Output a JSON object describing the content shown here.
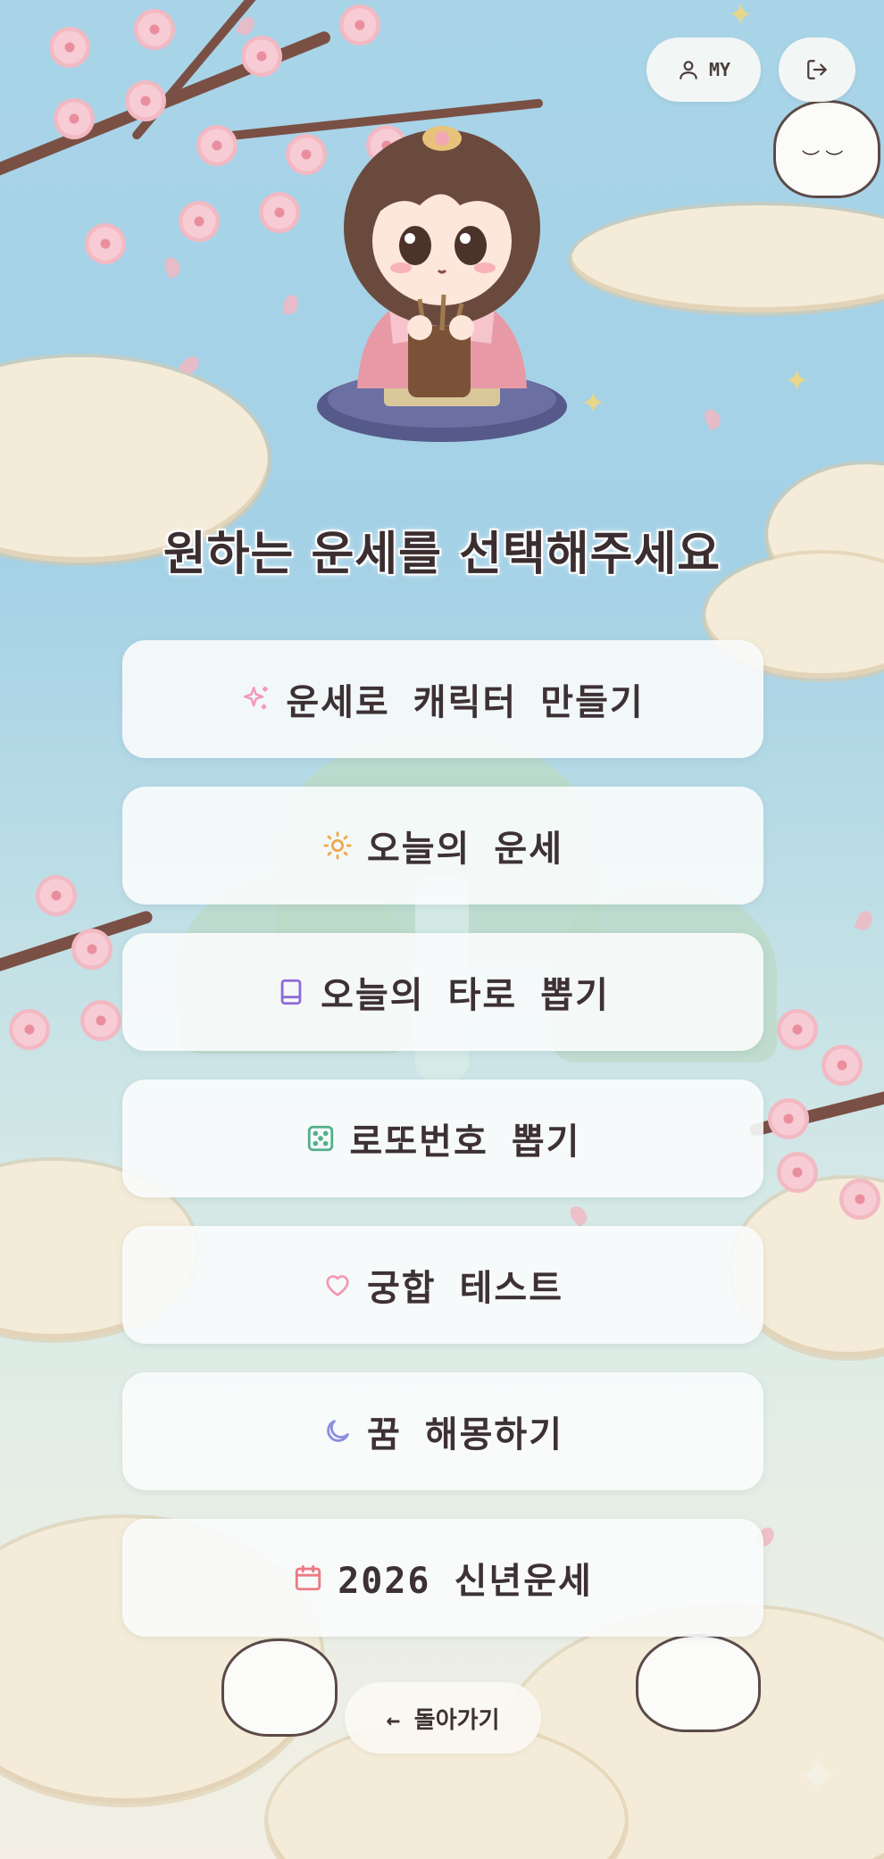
{
  "header": {
    "my_label": "MY",
    "my_icon": "user-icon",
    "logout_icon": "logout-icon"
  },
  "title": "원하는 운세를 선택해주세요",
  "menu": [
    {
      "label": "운세로 캐릭터 만들기",
      "icon": "sparkles-icon",
      "icon_color": "#f29ab8"
    },
    {
      "label": "오늘의 운세",
      "icon": "sun-icon",
      "icon_color": "#f0a94a"
    },
    {
      "label": "오늘의 타로 뽑기",
      "icon": "book-icon",
      "icon_color": "#8f6ad8"
    },
    {
      "label": "로또번호 뽑기",
      "icon": "dice-icon",
      "icon_color": "#54b08a"
    },
    {
      "label": "궁합 테스트",
      "icon": "heart-icon",
      "icon_color": "#f29ab8"
    },
    {
      "label": "꿈 해몽하기",
      "icon": "moon-icon",
      "icon_color": "#8a8fe0"
    },
    {
      "label": "2026 신년운세",
      "icon": "calendar-icon",
      "icon_color": "#ec7a84"
    }
  ],
  "back_label": "← 돌아가기"
}
